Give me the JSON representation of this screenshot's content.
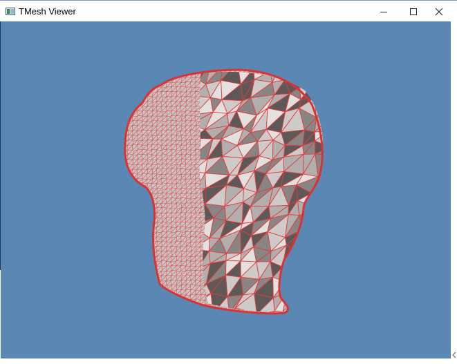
{
  "window": {
    "title": "TMesh Viewer",
    "app_icon": "app-window-icon",
    "controls": {
      "minimize": "minimize-icon",
      "maximize": "maximize-icon",
      "close": "close-icon"
    }
  },
  "viewport": {
    "background_color": "#5b87b5",
    "mesh_fill_color": "#b9b4b4",
    "mesh_shadow_color": "#6f6a6a",
    "mesh_wire_color": "#e23b3b"
  }
}
